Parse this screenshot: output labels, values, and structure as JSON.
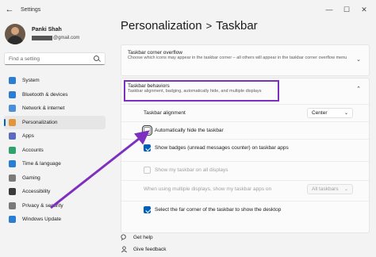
{
  "window": {
    "title": "Settings",
    "back_glyph": "←",
    "minimize": "—",
    "maximize": "☐",
    "close": "✕"
  },
  "profile": {
    "name": "Panki Shah",
    "email_visible": "@gmail.com"
  },
  "search": {
    "placeholder": "Find a setting"
  },
  "sidebar": {
    "items": [
      {
        "label": "System",
        "icon": "system-icon",
        "color": "#2b7cd3"
      },
      {
        "label": "Bluetooth & devices",
        "icon": "bluetooth-icon",
        "color": "#2b7cd3"
      },
      {
        "label": "Network & internet",
        "icon": "network-icon",
        "color": "#4a8fd8"
      },
      {
        "label": "Personalization",
        "icon": "brush-icon",
        "color": "#e0963a"
      },
      {
        "label": "Apps",
        "icon": "apps-icon",
        "color": "#5c6bc0"
      },
      {
        "label": "Accounts",
        "icon": "accounts-icon",
        "color": "#2fa36b"
      },
      {
        "label": "Time & language",
        "icon": "globe-icon",
        "color": "#2b7cd3"
      },
      {
        "label": "Gaming",
        "icon": "gaming-icon",
        "color": "#7a7a7a"
      },
      {
        "label": "Accessibility",
        "icon": "accessibility-icon",
        "color": "#3a3a3a"
      },
      {
        "label": "Privacy & security",
        "icon": "shield-icon",
        "color": "#7a7a7a"
      },
      {
        "label": "Windows Update",
        "icon": "update-icon",
        "color": "#2b7cd3"
      }
    ],
    "active_index": 3
  },
  "breadcrumb": {
    "parent": "Personalization",
    "separator": ">",
    "current": "Taskbar"
  },
  "overflow": {
    "title": "Taskbar corner overflow",
    "subtitle": "Choose which icons may appear in the taskbar corner – all others will appear in the taskbar corner overflow menu",
    "chevron": "⌄"
  },
  "behaviors": {
    "title": "Taskbar behaviors",
    "subtitle": "Taskbar alignment, badging, automatically hide, and multiple displays",
    "chevron": "⌃",
    "highlight_color": "#7d2fbf",
    "alignment_label": "Taskbar alignment",
    "alignment_value": "Center",
    "auto_hide_label": "Automatically hide the taskbar",
    "auto_hide_checked": false,
    "badges_label": "Show badges (unread messages counter) on taskbar apps",
    "badges_checked": true,
    "all_displays_label": "Show my taskbar on all displays",
    "all_displays_checked": false,
    "multi_display_label": "When using multiple displays, show my taskbar apps on",
    "multi_display_value": "All taskbars",
    "far_corner_label": "Select the far corner of the taskbar to show the desktop",
    "far_corner_checked": true
  },
  "help": {
    "get_help": "Get help",
    "give_feedback": "Give feedback"
  },
  "accent_color": "#005fb8",
  "arrow_color": "#7d2fbf",
  "dropdown_chevron": "⌄"
}
